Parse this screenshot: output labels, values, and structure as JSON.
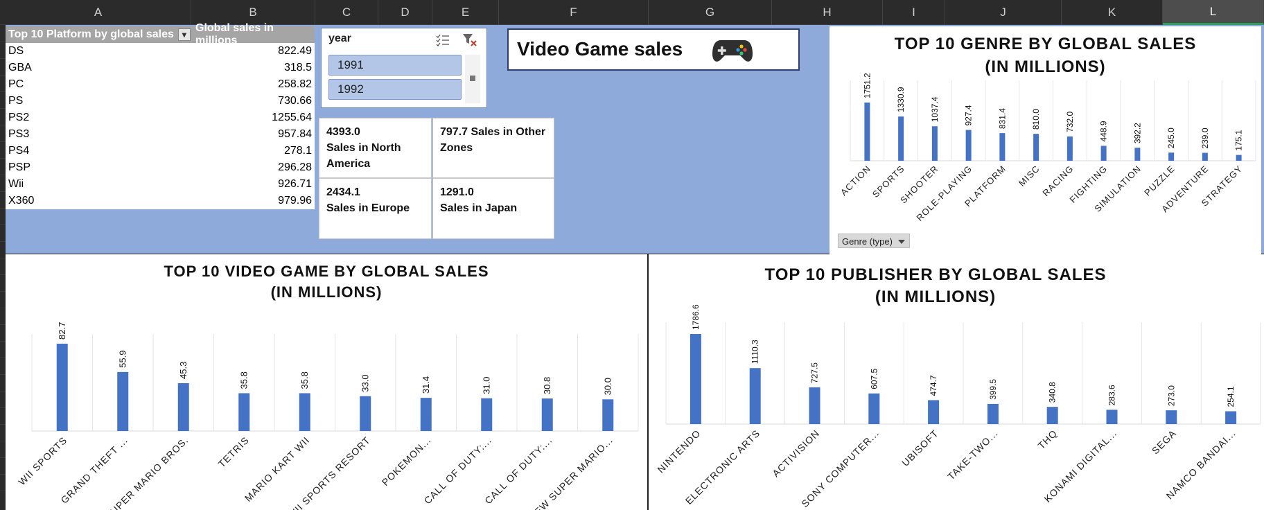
{
  "columns": [
    "A",
    "B",
    "C",
    "D",
    "E",
    "F",
    "G",
    "H",
    "I",
    "J",
    "K",
    "L"
  ],
  "pivot": {
    "header_col1": "Top 10 Platform by global sales",
    "header_col2": "Global sales in millions",
    "rows": [
      {
        "platform": "DS",
        "sales": "822.49"
      },
      {
        "platform": "GBA",
        "sales": "318.5"
      },
      {
        "platform": "PC",
        "sales": "258.82"
      },
      {
        "platform": "PS",
        "sales": "730.66"
      },
      {
        "platform": "PS2",
        "sales": "1255.64"
      },
      {
        "platform": "PS3",
        "sales": "957.84"
      },
      {
        "platform": "PS4",
        "sales": "278.1"
      },
      {
        "platform": "PSP",
        "sales": "296.28"
      },
      {
        "platform": "Wii",
        "sales": "926.71"
      },
      {
        "platform": "X360",
        "sales": "979.96"
      }
    ]
  },
  "slicer": {
    "title": "year",
    "items": [
      "1991",
      "1992"
    ]
  },
  "cards": {
    "na_value": "4393.0",
    "na_label": "Sales in North America",
    "other_value": "797.7",
    "other_label": "Sales in Other Zones",
    "eu_value": "2434.1",
    "eu_label": "Sales in Europe",
    "jp_value": "1291.0",
    "jp_label": "Sales in Japan"
  },
  "title_box": {
    "title": "Video Game sales",
    "icon": "gamepad-icon"
  },
  "genre_filter": {
    "label": "Genre (type)"
  },
  "colors": {
    "bar": "#4472c4",
    "background": "#8eaadb"
  },
  "chart_data": [
    {
      "type": "bar",
      "title_line1": "TOP 10 GENRE BY GLOBAL SALES",
      "title_line2": "(IN MILLIONS)",
      "categories": [
        "ACTION",
        "SPORTS",
        "SHOOTER",
        "ROLE-PLAYING",
        "PLATFORM",
        "MISC",
        "RACING",
        "FIGHTING",
        "SIMULATION",
        "PUZZLE",
        "ADVENTURE",
        "STRATEGY"
      ],
      "values": [
        1751.2,
        1330.9,
        1037.4,
        927.4,
        831.4,
        810.0,
        732.0,
        448.9,
        392.2,
        245.0,
        239.0,
        175.1
      ],
      "value_labels": [
        "1751.2",
        "1330.9",
        "1037.4",
        "927.4",
        "831.4",
        "810.0",
        "732.0",
        "448.9",
        "392.2",
        "245.0",
        "239.0",
        "175.1"
      ]
    },
    {
      "type": "bar",
      "title_line1": "TOP 10 VIDEO GAME BY GLOBAL SALES",
      "title_line2": "(IN MILLIONS)",
      "categories": [
        "WII SPORTS",
        "GRAND THEFT ...",
        "SUPER MARIO BROS.",
        "TETRIS",
        "MARIO KART WII",
        "WII SPORTS RESORT",
        "POKEMON...",
        "CALL OF DUTY:...",
        "CALL OF DUTY:...",
        "NEW SUPER MARIO..."
      ],
      "values": [
        82.7,
        55.9,
        45.3,
        35.8,
        35.8,
        33.0,
        31.4,
        31.0,
        30.8,
        30.0
      ],
      "value_labels": [
        "82.7",
        "55.9",
        "45.3",
        "35.8",
        "35.8",
        "33.0",
        "31.4",
        "31.0",
        "30.8",
        "30.0"
      ]
    },
    {
      "type": "bar",
      "title_line1": "TOP 10 PUBLISHER BY GLOBAL SALES",
      "title_line2": "(IN MILLIONS)",
      "categories": [
        "NINTENDO",
        "ELECTRONIC ARTS",
        "ACTIVISION",
        "SONY COMPUTER...",
        "UBISOFT",
        "TAKE-TWO...",
        "THQ",
        "KONAMI DIGITAL...",
        "SEGA",
        "NAMCO BANDAI..."
      ],
      "values": [
        1786.6,
        1110.3,
        727.5,
        607.5,
        474.7,
        399.5,
        340.8,
        283.6,
        273.0,
        254.1
      ],
      "value_labels": [
        "1786.6",
        "1110.3",
        "727.5",
        "607.5",
        "474.7",
        "399.5",
        "340.8",
        "283.6",
        "273.0",
        "254.1"
      ]
    }
  ]
}
